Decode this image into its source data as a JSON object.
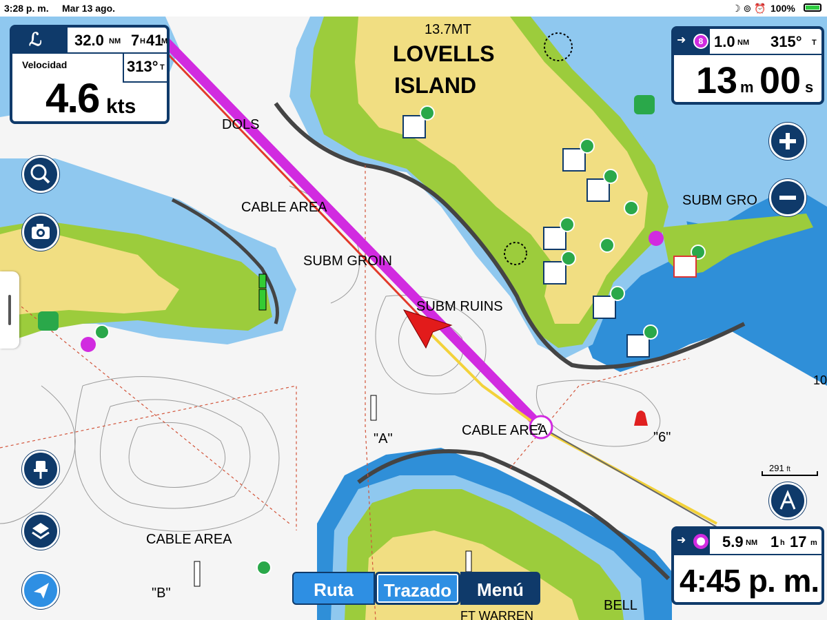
{
  "status_bar": {
    "time": "3:28 p. m.",
    "date": "Mar 13 ago.",
    "battery": "100%"
  },
  "map_labels": {
    "depth_13_7": "13.7MT",
    "lovells": "LOVELLS",
    "island": "ISLAND",
    "dols": "DOLS",
    "cable_area_1": "CABLE AREA",
    "subm_groin": "SUBM GROIN",
    "subm_ruins": "SUBM RUINS",
    "cable_area_2": "CABLE AREA",
    "cable_area_3": "CABLE AREA",
    "subm_gro": "SUBM GRO",
    "buoy_a": "\"A\"",
    "buoy_b": "\"B\"",
    "buoy_6": "\"6\"",
    "bell": "BELL",
    "ft_warren": "FT WARREN",
    "depth_10": "10",
    "route_point_7": "7"
  },
  "scale": {
    "value": "291",
    "unit": "ft"
  },
  "speed_panel": {
    "distance_value": "32.0",
    "distance_unit": "NM",
    "time_h": "7",
    "time_h_unit": "H",
    "time_m": "41",
    "time_m_unit": "M",
    "label": "Velocidad",
    "heading": "313°",
    "heading_unit": "T",
    "speed": "4.6",
    "speed_unit": "kts"
  },
  "waypoint_panel": {
    "waypoint_number": "8",
    "distance": "1.0",
    "distance_unit": "NM",
    "bearing": "315°",
    "bearing_unit": "T",
    "eta_m": "13",
    "eta_m_unit": "m",
    "eta_s": "00",
    "eta_s_unit": "s"
  },
  "destination_panel": {
    "distance": "5.9",
    "distance_unit": "NM",
    "time_h": "1",
    "time_h_unit": "h",
    "time_m": "17",
    "time_m_unit": "m",
    "arrival": "4:45 p. m."
  },
  "tabs": {
    "route": "Ruta",
    "track": "Trazado",
    "menu": "Menú"
  },
  "colors": {
    "land": "#f1de82",
    "vegetation": "#9ccc3c",
    "deep_water": "#2f8fd8",
    "shallow_water": "#8fc8ef",
    "chart_white": "#f5f5f5",
    "route": "#d12be0",
    "track": "#e23a2a",
    "panel_border": "#0f3a6a",
    "tab_active": "#2e8fe3"
  }
}
